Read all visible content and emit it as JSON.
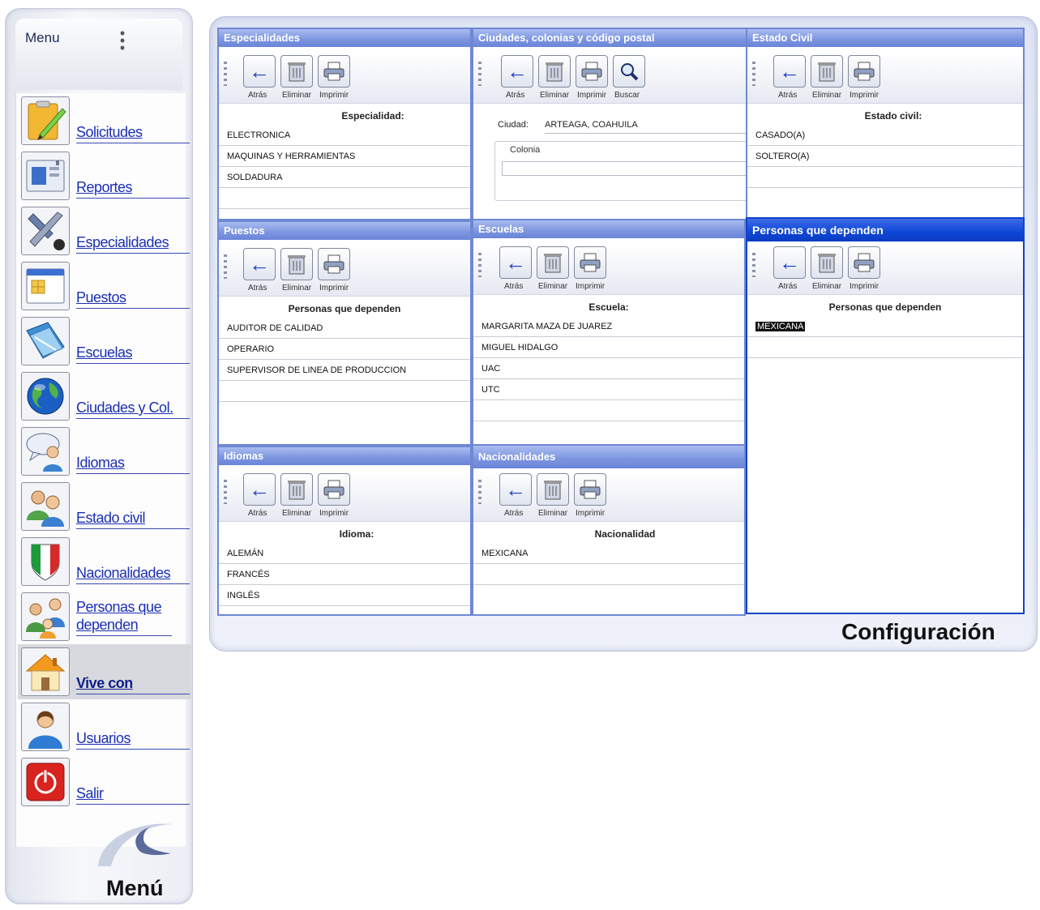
{
  "menu": {
    "title": "Menu",
    "caption": "Menú",
    "items": [
      {
        "label": "Solicitudes",
        "icon": "clipboard-pencil-icon"
      },
      {
        "label": "Reportes",
        "icon": "window-report-icon"
      },
      {
        "label": "Especialidades",
        "icon": "tools-icon"
      },
      {
        "label": "Puestos",
        "icon": "form-window-icon"
      },
      {
        "label": "Escuelas",
        "icon": "books-icon"
      },
      {
        "label": "Ciudades y Col.",
        "icon": "globe-icon"
      },
      {
        "label": "Idiomas",
        "icon": "speech-person-icon"
      },
      {
        "label": "Estado civil",
        "icon": "couple-icon"
      },
      {
        "label": "Nacionalidades",
        "icon": "flag-shield-icon"
      },
      {
        "label": "Personas que dependen",
        "icon": "family-icon"
      },
      {
        "label": "Vive con",
        "icon": "house-icon",
        "active": true
      },
      {
        "label": "Usuarios",
        "icon": "user-icon"
      },
      {
        "label": "Salir",
        "icon": "power-icon"
      }
    ]
  },
  "config": {
    "caption": "Configuración",
    "toolbar_labels": {
      "back": "Atrás",
      "delete": "Eliminar",
      "print": "Imprimir",
      "search": "Buscar"
    },
    "panels": {
      "especialidades": {
        "title": "Especialidades",
        "field": "Especialidad:",
        "rows": [
          "ELECTRONICA",
          "MAQUINAS Y HERRAMIENTAS",
          "SOLDADURA"
        ]
      },
      "ciudades": {
        "title": "Ciudades, colonias y código postal",
        "city_label": "Ciudad:",
        "city_value": "ARTEAGA, COAHUILA",
        "colonia_label": "Colonia"
      },
      "estado_civil": {
        "title": "Estado Civil",
        "field": "Estado civil:",
        "rows": [
          "CASADO(A)",
          "SOLTERO(A)"
        ]
      },
      "puestos": {
        "title": "Puestos",
        "field": "Personas que dependen",
        "rows": [
          "AUDITOR DE CALIDAD",
          "OPERARIO",
          "SUPERVISOR DE LINEA DE PRODUCCION"
        ]
      },
      "escuelas": {
        "title": "Escuelas",
        "field": "Escuela:",
        "rows": [
          "MARGARITA MAZA DE JUAREZ",
          "MIGUEL HIDALGO",
          "UAC",
          "UTC"
        ]
      },
      "personas": {
        "title": "Personas que dependen",
        "field": "Personas que dependen",
        "rows": [
          "MEXICANA"
        ]
      },
      "idiomas": {
        "title": "Idiomas",
        "field": "Idioma:",
        "rows": [
          "ALEMÁN",
          "FRANCÉS",
          "INGLÉS"
        ]
      },
      "nacionalidades": {
        "title": "Nacionalidades",
        "field": "Nacionalidad",
        "rows": [
          "MEXICANA"
        ]
      }
    }
  },
  "colors": {
    "panel_header": "#7f97e0",
    "panel_header_selected": "#0e46d6",
    "link": "#1a2fb4"
  }
}
